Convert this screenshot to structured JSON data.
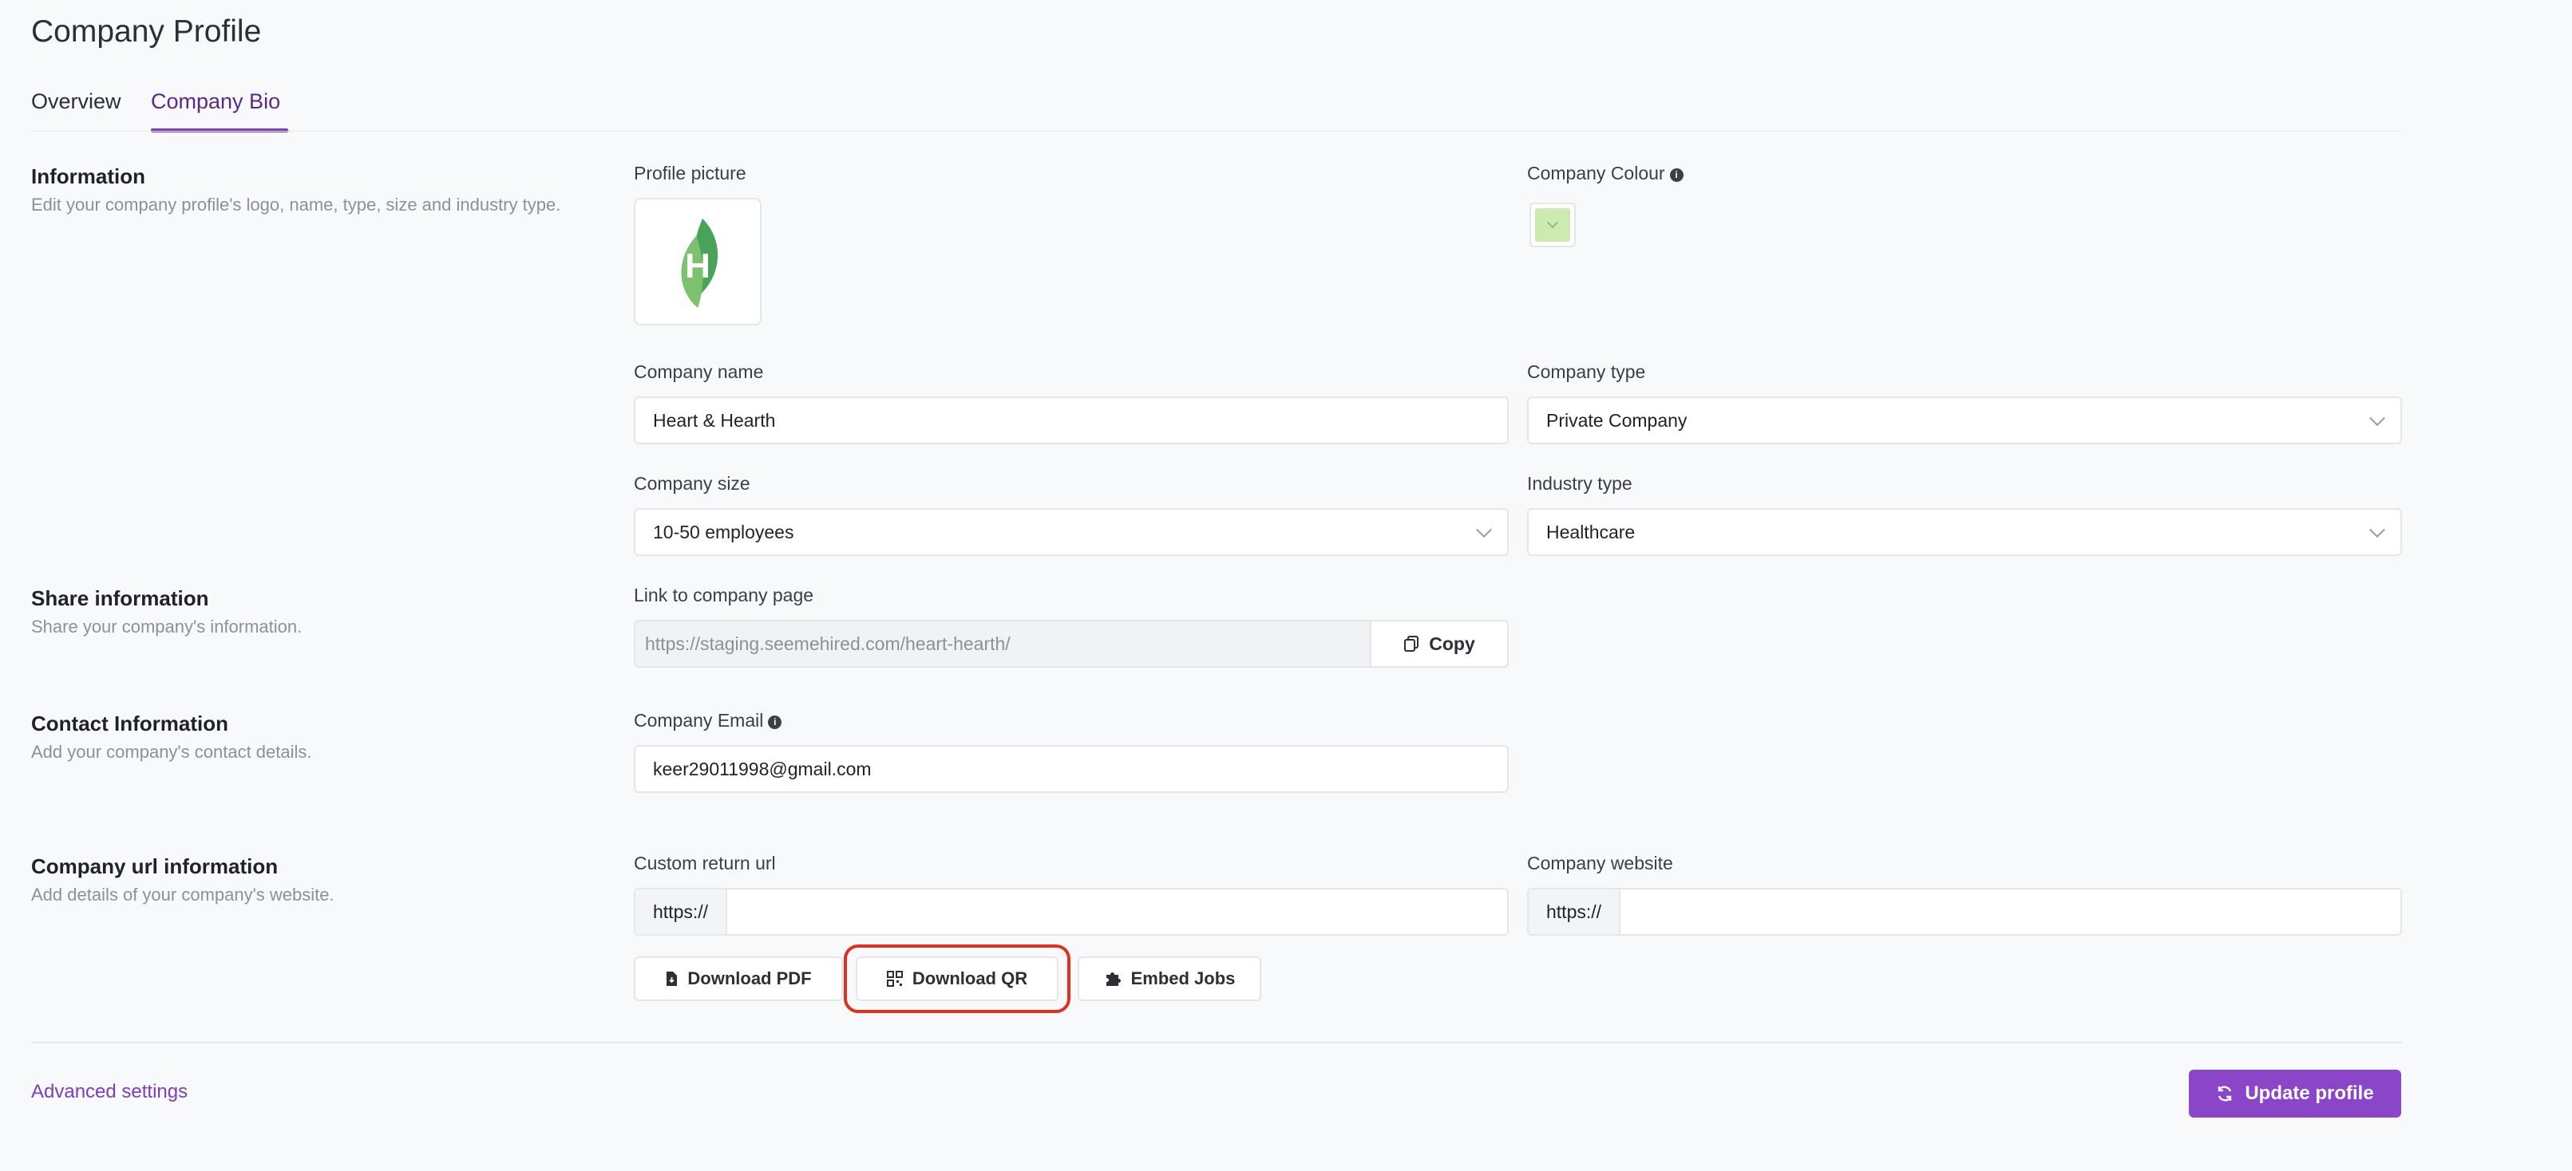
{
  "page": {
    "title": "Company Profile"
  },
  "tabs": [
    {
      "label": "Overview",
      "active": false
    },
    {
      "label": "Company Bio",
      "active": true
    }
  ],
  "sections": {
    "information": {
      "title": "Information",
      "description": "Edit your company profile's logo, name, type, size and industry type."
    },
    "share": {
      "title": "Share information",
      "description": "Share your company's information."
    },
    "contact": {
      "title": "Contact Information",
      "description": "Add your company's contact details."
    },
    "url": {
      "title": "Company url information",
      "description": "Add details of your company's website."
    }
  },
  "fields": {
    "profile_picture": {
      "label": "Profile picture",
      "logo_letter": "H"
    },
    "company_colour": {
      "label": "Company Colour",
      "value_color": "#cdeab0"
    },
    "company_name": {
      "label": "Company name",
      "value": "Heart & Hearth"
    },
    "company_type": {
      "label": "Company type",
      "value": "Private Company"
    },
    "company_size": {
      "label": "Company size",
      "value": "10-50 employees"
    },
    "industry_type": {
      "label": "Industry type",
      "value": "Healthcare"
    },
    "company_link": {
      "label": "Link to company page",
      "value": "https://staging.seemehired.com/heart-hearth/",
      "copy_label": "Copy"
    },
    "company_email": {
      "label": "Company Email",
      "value": "keer29011998@gmail.com"
    },
    "custom_return_url": {
      "label": "Custom return url",
      "prefix": "https://",
      "value": ""
    },
    "company_website": {
      "label": "Company website",
      "prefix": "https://",
      "value": ""
    }
  },
  "actions": {
    "download_pdf": "Download PDF",
    "download_qr": "Download QR",
    "embed_jobs": "Embed Jobs"
  },
  "footer": {
    "advanced_settings": "Advanced settings",
    "update_profile": "Update profile"
  },
  "colors": {
    "accent": "#8a45c9",
    "tab_active": "#5b2a86",
    "highlight": "#e0301e"
  }
}
